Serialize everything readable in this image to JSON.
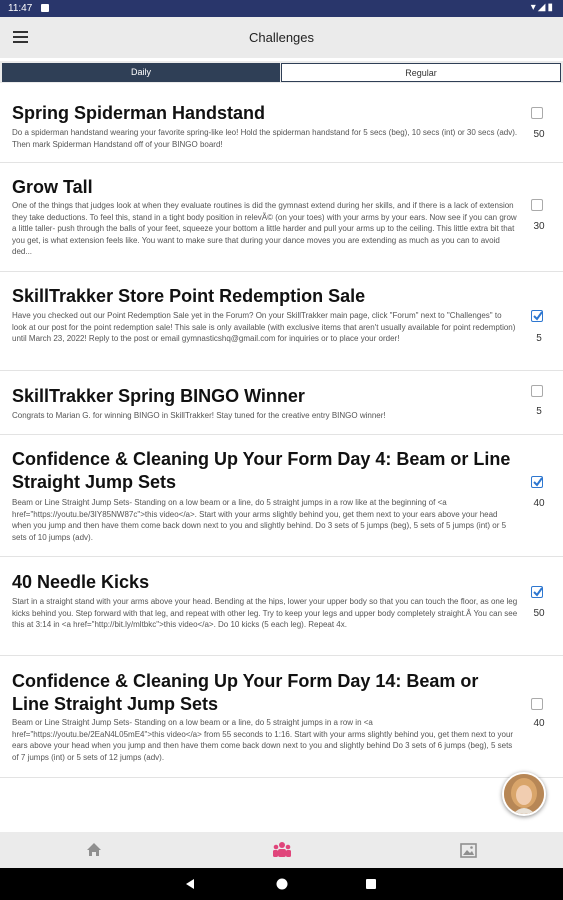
{
  "status_bar": {
    "time": "11:47"
  },
  "app_bar": {
    "title": "Challenges"
  },
  "tabs": [
    {
      "label": "Daily",
      "active": true
    },
    {
      "label": "Regular",
      "active": false
    }
  ],
  "challenges": [
    {
      "title": "Spring Spiderman Handstand",
      "description": "Do a spiderman handstand wearing your favorite spring-like leo! Hold the spiderman handstand for 5 secs (beg), 10 secs (int) or 30 secs (adv). Then mark Spiderman Handstand off of your BINGO board!",
      "points": "50",
      "checked": false
    },
    {
      "title": "Grow Tall",
      "description": "One of the things that judges look at when they evaluate routines is did the gymnast extend during her skills, and if there is a lack of extension they take deductions. To feel this, stand in a tight body position in relevÃ© (on your toes) with your arms by your ears. Now see if you can grow a little taller- push through the balls of your feet, squeeze your bottom a little harder and pull your arms up to the ceiling. This little extra bit that you get, is what extension feels like. You want to make sure that during your dance moves you are extending as much as you can to avoid ded...",
      "points": "30",
      "checked": false
    },
    {
      "title": "SkillTrakker Store Point Redemption Sale",
      "description": "Have you checked out our Point Redemption Sale yet in the Forum? On your SkillTrakker main page, click \"Forum\" next to \"Challenges\" to look at our post for the point redemption sale! This sale is only available (with exclusive items that aren't usually available for point redemption) until March 23, 2022! Reply to the post or email gymnasticshq@gmail.com for inquiries or to place your order!",
      "points": "5",
      "checked": true
    },
    {
      "title": "SkillTrakker Spring BINGO Winner",
      "description": "Congrats to Marian G. for winning BINGO in SkillTrakker! Stay tuned for the creative entry BINGO winner!",
      "points": "5",
      "checked": false
    },
    {
      "title": "Confidence & Cleaning Up Your Form Day 4: Beam or Line Straight Jump Sets",
      "description": "Beam or Line Straight Jump Sets- Standing on a low beam or a line, do 5 straight jumps in a row like at the beginning of <a href=\"https://youtu.be/3IY85NW87c\">this video</a>. Start with your arms slightly behind you, get them next to your ears above your head when you jump and then have them come back down next to you and slightly behind. Do 3 sets of 5 jumps (beg), 5 sets of 5 jumps (int) or 5 sets of 10 jumps (adv).",
      "points": "40",
      "checked": true
    },
    {
      "title": "40 Needle Kicks",
      "description": "Start in a straight stand with your arms above your head. Bending at the hips, lower your upper body so that you can touch the floor, as one leg kicks behind you. Step forward with that leg, and repeat with other leg. Try to keep your legs and upper body completely straight.Â You can see this at 3:14 in <a href=\"http://bit.ly/mltbkc\">this video</a>. Do 10 kicks (5 each leg). Repeat 4x.",
      "points": "50",
      "checked": true
    },
    {
      "title": "Confidence & Cleaning Up Your Form Day 14: Beam or Line Straight Jump Sets",
      "description": "Beam or Line Straight Jump Sets- Standing on a low beam or a line, do 5 straight jumps in a row in <a href=\"https://youtu.be/2EaN4L05mE4\">this video</a> from 55 seconds to 1:16. Start with your arms slightly behind you, get them next to your ears above your head when you jump and then have them come back down next to you and slightly behind Do 3 sets of 6 jumps (beg), 5 sets of 7 jumps (int) or 5 sets of 12 jumps (adv).",
      "points": "40",
      "checked": false
    }
  ],
  "icons": {
    "menu": "menu-icon",
    "home": "home-icon",
    "community": "community-icon",
    "gallery": "image-icon"
  },
  "colors": {
    "status_bar": "#29366b",
    "tab_active": "#2f3f56",
    "checkbox": "#2e77d0",
    "nav_active": "#e0457b"
  }
}
